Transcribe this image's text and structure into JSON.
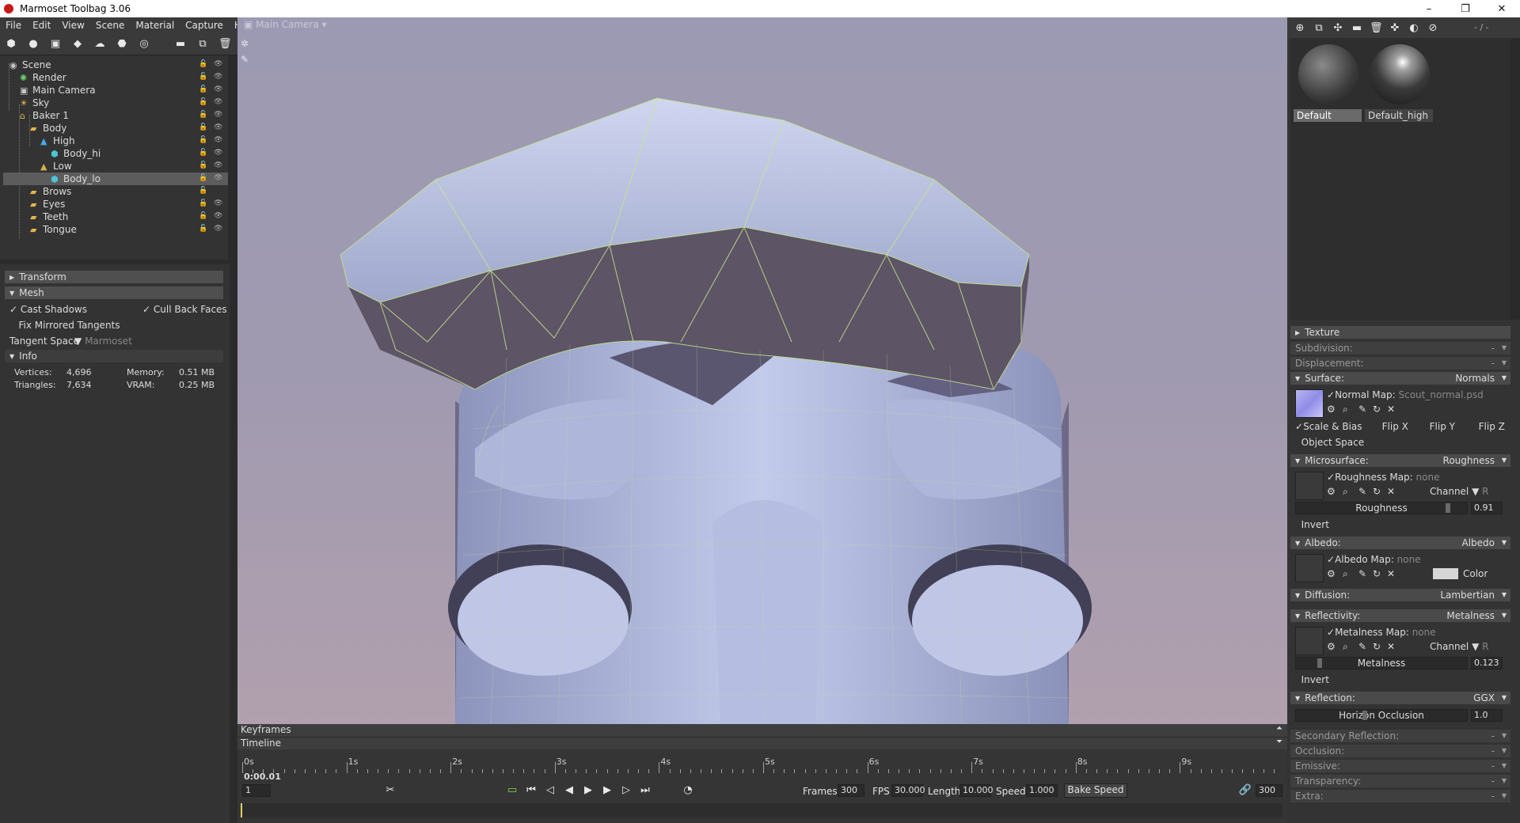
{
  "window": {
    "title": "Marmoset Toolbag 3.06",
    "minimize": "–",
    "restore": "❐",
    "close": "✕"
  },
  "menu": [
    "File",
    "Edit",
    "View",
    "Scene",
    "Material",
    "Capture",
    "Help"
  ],
  "outliner": {
    "items": [
      {
        "label": "Scene",
        "icon": "scene-icon",
        "color": "#c8c8c8",
        "indent": 0,
        "selected": false
      },
      {
        "label": "Render",
        "icon": "render-icon",
        "color": "#6ccf6c",
        "indent": 1,
        "selected": false
      },
      {
        "label": "Main Camera",
        "icon": "camera-icon",
        "color": "#c8c8c8",
        "indent": 1,
        "selected": false
      },
      {
        "label": "Sky",
        "icon": "sky-icon",
        "color": "#e8b84a",
        "indent": 1,
        "selected": false
      },
      {
        "label": "Baker 1",
        "icon": "baker-icon",
        "color": "#e8b84a",
        "indent": 1,
        "selected": false
      },
      {
        "label": "Body",
        "icon": "folder-icon",
        "color": "#e3b54b",
        "indent": 2,
        "selected": false
      },
      {
        "label": "High",
        "icon": "high-icon",
        "color": "#4aa8e8",
        "indent": 3,
        "selected": false
      },
      {
        "label": "Body_hi",
        "icon": "mesh-icon",
        "color": "#4fc3d6",
        "indent": 4,
        "selected": false
      },
      {
        "label": "Low",
        "icon": "low-icon",
        "color": "#d8b04a",
        "indent": 3,
        "selected": false
      },
      {
        "label": "Body_lo",
        "icon": "mesh-icon",
        "color": "#4fc3d6",
        "indent": 4,
        "selected": true
      },
      {
        "label": "Brows",
        "icon": "folder-icon",
        "color": "#e3b54b",
        "indent": 2,
        "selected": false
      },
      {
        "label": "Eyes",
        "icon": "folder-icon",
        "color": "#e3b54b",
        "indent": 2,
        "selected": false
      },
      {
        "label": "Teeth",
        "icon": "folder-icon",
        "color": "#e3b54b",
        "indent": 2,
        "selected": false
      },
      {
        "label": "Tongue",
        "icon": "folder-icon",
        "color": "#e3b54b",
        "indent": 2,
        "selected": false
      }
    ]
  },
  "props": {
    "transform": "Transform",
    "mesh": "Mesh",
    "cast_shadows": "Cast Shadows",
    "cull_back_faces": "Cull Back Faces",
    "fix_mirrored": "Fix Mirrored Tangents",
    "tangent_space_label": "Tangent Space",
    "tangent_space_value": "Marmoset",
    "info": "Info",
    "vertices_label": "Vertices:",
    "vertices": "4,696",
    "memory_label": "Memory:",
    "memory": "0.51 MB",
    "triangles_label": "Triangles:",
    "triangles": "7,634",
    "vram_label": "VRAM:",
    "vram": "0.25 MB"
  },
  "viewport": {
    "camera": "Main Camera"
  },
  "timeline": {
    "keyframes": "Keyframes",
    "timeline": "Timeline",
    "ticks": [
      "0s",
      "1s",
      "2s",
      "3s",
      "4s",
      "5s",
      "6s",
      "7s",
      "8s",
      "9s"
    ],
    "current_time": "0:00.01",
    "frame_field": "1",
    "frames_label": "Frames",
    "frames": "300",
    "fps_label": "FPS",
    "fps": "30.000",
    "length_label": "Length",
    "length": "10.000",
    "speed_label": "Speed",
    "speed": "1.000",
    "bake_speed": "Bake Speed",
    "end_frame": "300"
  },
  "materials": {
    "slot_count": "- / -",
    "items": [
      {
        "name": "Default"
      },
      {
        "name": "Default_high"
      }
    ]
  },
  "matprops": {
    "texture": "Texture",
    "subdivision": "Subdivision:",
    "subdivision_val": "-",
    "displacement": "Displacement:",
    "displacement_val": "-",
    "surface": "Surface:",
    "surface_val": "Normals",
    "normal_map_label": "Normal Map:",
    "normal_map": "Scout_normal.psd",
    "scale_bias": "Scale & Bias",
    "flip_x": "Flip X",
    "flip_y": "Flip Y",
    "flip_z": "Flip Z",
    "object_space": "Object Space",
    "microsurface": "Microsurface:",
    "microsurface_val": "Roughness",
    "roughness_map_label": "Roughness Map:",
    "roughness_map": "none",
    "channel": "Channel",
    "channel_val": "R",
    "roughness": "Roughness",
    "roughness_val": "0.91",
    "invert": "Invert",
    "albedo": "Albedo:",
    "albedo_val": "Albedo",
    "albedo_map_label": "Albedo Map:",
    "albedo_map": "none",
    "color": "Color",
    "diffusion": "Diffusion:",
    "diffusion_val": "Lambertian",
    "reflectivity": "Reflectivity:",
    "reflectivity_val": "Metalness",
    "metalness_map_label": "Metalness Map:",
    "metalness_map": "none",
    "metalness": "Metalness",
    "metalness_val": "0.123",
    "reflection": "Reflection:",
    "reflection_val": "GGX",
    "horizon": "Horizon Occlusion",
    "horizon_val": "1.0",
    "secondary": "Secondary Reflection:",
    "secondary_val": "-",
    "occlusion": "Occlusion:",
    "occlusion_val": "-",
    "emissive": "Emissive:",
    "emissive_val": "-",
    "transparency": "Transparency:",
    "transparency_val": "-",
    "extra": "Extra:",
    "extra_val": "-"
  },
  "colors": {
    "selection": "#5c5c5c",
    "wireframe": "#c6e68a",
    "mesh": "#b9c2e6"
  }
}
